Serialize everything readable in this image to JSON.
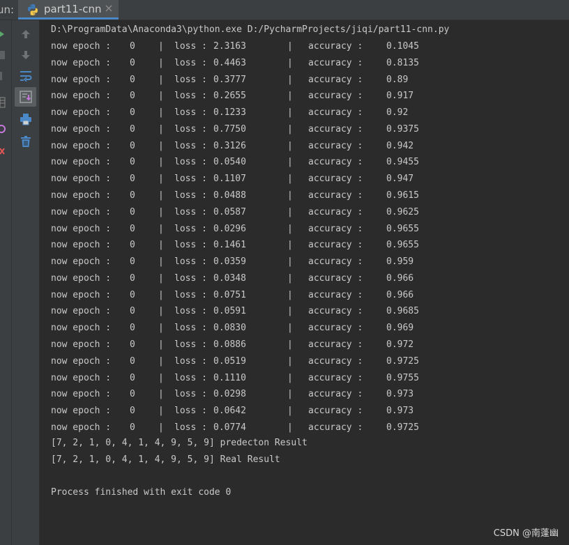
{
  "run_panel": {
    "label": "un:",
    "tab": {
      "title": "part11-cnn",
      "icon": "python-icon",
      "close_glyph": "×"
    }
  },
  "toolbar": {
    "buttons": [
      {
        "name": "scroll-up-icon",
        "label": "up"
      },
      {
        "name": "scroll-down-icon",
        "label": "down"
      },
      {
        "name": "soft-wrap-icon",
        "label": "wrap"
      },
      {
        "name": "scroll-to-end-icon",
        "label": "scroll to end"
      },
      {
        "name": "print-icon",
        "label": "print"
      },
      {
        "name": "trash-icon",
        "label": "clear"
      }
    ]
  },
  "console": {
    "command": "D:\\ProgramData\\Anaconda3\\python.exe D:/PycharmProjects/jiqi/part11-cnn.py",
    "rows": [
      {
        "epoch_label": "now epoch :",
        "epoch": "0",
        "sep1": "|",
        "loss_label": "loss :",
        "loss": "2.3163",
        "sep2": "|",
        "acc_label": "accuracy :",
        "acc": "0.1045"
      },
      {
        "epoch_label": "now epoch :",
        "epoch": "0",
        "sep1": "|",
        "loss_label": "loss :",
        "loss": "0.4463",
        "sep2": "|",
        "acc_label": "accuracy :",
        "acc": "0.8135"
      },
      {
        "epoch_label": "now epoch :",
        "epoch": "0",
        "sep1": "|",
        "loss_label": "loss :",
        "loss": "0.3777",
        "sep2": "|",
        "acc_label": "accuracy :",
        "acc": "0.89"
      },
      {
        "epoch_label": "now epoch :",
        "epoch": "0",
        "sep1": "|",
        "loss_label": "loss :",
        "loss": "0.2655",
        "sep2": "|",
        "acc_label": "accuracy :",
        "acc": "0.917"
      },
      {
        "epoch_label": "now epoch :",
        "epoch": "0",
        "sep1": "|",
        "loss_label": "loss :",
        "loss": "0.1233",
        "sep2": "|",
        "acc_label": "accuracy :",
        "acc": "0.92"
      },
      {
        "epoch_label": "now epoch :",
        "epoch": "0",
        "sep1": "|",
        "loss_label": "loss :",
        "loss": "0.7750",
        "sep2": "|",
        "acc_label": "accuracy :",
        "acc": "0.9375"
      },
      {
        "epoch_label": "now epoch :",
        "epoch": "0",
        "sep1": "|",
        "loss_label": "loss :",
        "loss": "0.3126",
        "sep2": "|",
        "acc_label": "accuracy :",
        "acc": "0.942"
      },
      {
        "epoch_label": "now epoch :",
        "epoch": "0",
        "sep1": "|",
        "loss_label": "loss :",
        "loss": "0.0540",
        "sep2": "|",
        "acc_label": "accuracy :",
        "acc": "0.9455"
      },
      {
        "epoch_label": "now epoch :",
        "epoch": "0",
        "sep1": "|",
        "loss_label": "loss :",
        "loss": "0.1107",
        "sep2": "|",
        "acc_label": "accuracy :",
        "acc": "0.947"
      },
      {
        "epoch_label": "now epoch :",
        "epoch": "0",
        "sep1": "|",
        "loss_label": "loss :",
        "loss": "0.0488",
        "sep2": "|",
        "acc_label": "accuracy :",
        "acc": "0.9615"
      },
      {
        "epoch_label": "now epoch :",
        "epoch": "0",
        "sep1": "|",
        "loss_label": "loss :",
        "loss": "0.0587",
        "sep2": "|",
        "acc_label": "accuracy :",
        "acc": "0.9625"
      },
      {
        "epoch_label": "now epoch :",
        "epoch": "0",
        "sep1": "|",
        "loss_label": "loss :",
        "loss": "0.0296",
        "sep2": "|",
        "acc_label": "accuracy :",
        "acc": "0.9655"
      },
      {
        "epoch_label": "now epoch :",
        "epoch": "0",
        "sep1": "|",
        "loss_label": "loss :",
        "loss": "0.1461",
        "sep2": "|",
        "acc_label": "accuracy :",
        "acc": "0.9655"
      },
      {
        "epoch_label": "now epoch :",
        "epoch": "0",
        "sep1": "|",
        "loss_label": "loss :",
        "loss": "0.0359",
        "sep2": "|",
        "acc_label": "accuracy :",
        "acc": "0.959"
      },
      {
        "epoch_label": "now epoch :",
        "epoch": "0",
        "sep1": "|",
        "loss_label": "loss :",
        "loss": "0.0348",
        "sep2": "|",
        "acc_label": "accuracy :",
        "acc": "0.966"
      },
      {
        "epoch_label": "now epoch :",
        "epoch": "0",
        "sep1": "|",
        "loss_label": "loss :",
        "loss": "0.0751",
        "sep2": "|",
        "acc_label": "accuracy :",
        "acc": "0.966"
      },
      {
        "epoch_label": "now epoch :",
        "epoch": "0",
        "sep1": "|",
        "loss_label": "loss :",
        "loss": "0.0591",
        "sep2": "|",
        "acc_label": "accuracy :",
        "acc": "0.9685"
      },
      {
        "epoch_label": "now epoch :",
        "epoch": "0",
        "sep1": "|",
        "loss_label": "loss :",
        "loss": "0.0830",
        "sep2": "|",
        "acc_label": "accuracy :",
        "acc": "0.969"
      },
      {
        "epoch_label": "now epoch :",
        "epoch": "0",
        "sep1": "|",
        "loss_label": "loss :",
        "loss": "0.0886",
        "sep2": "|",
        "acc_label": "accuracy :",
        "acc": "0.972"
      },
      {
        "epoch_label": "now epoch :",
        "epoch": "0",
        "sep1": "|",
        "loss_label": "loss :",
        "loss": "0.0519",
        "sep2": "|",
        "acc_label": "accuracy :",
        "acc": "0.9725"
      },
      {
        "epoch_label": "now epoch :",
        "epoch": "0",
        "sep1": "|",
        "loss_label": "loss :",
        "loss": "0.1110",
        "sep2": "|",
        "acc_label": "accuracy :",
        "acc": "0.9755"
      },
      {
        "epoch_label": "now epoch :",
        "epoch": "0",
        "sep1": "|",
        "loss_label": "loss :",
        "loss": "0.0298",
        "sep2": "|",
        "acc_label": "accuracy :",
        "acc": "0.973"
      },
      {
        "epoch_label": "now epoch :",
        "epoch": "0",
        "sep1": "|",
        "loss_label": "loss :",
        "loss": "0.0642",
        "sep2": "|",
        "acc_label": "accuracy :",
        "acc": "0.973"
      },
      {
        "epoch_label": "now epoch :",
        "epoch": "0",
        "sep1": "|",
        "loss_label": "loss :",
        "loss": "0.0774",
        "sep2": "|",
        "acc_label": "accuracy :",
        "acc": "0.9725"
      }
    ],
    "prediction_line": "[7, 2, 1, 0, 4, 1, 4, 9, 5, 9] predecton Result",
    "real_line": "[7, 2, 1, 0, 4, 1, 4, 9, 5, 9] Real Result",
    "exit_line": "Process finished with exit code 0"
  },
  "watermark": "CSDN @南蓬幽",
  "colors": {
    "background": "#2b2b2b",
    "panel": "#3c3f41",
    "text": "#c9c9c9",
    "tab_underline": "#4a88c7"
  }
}
